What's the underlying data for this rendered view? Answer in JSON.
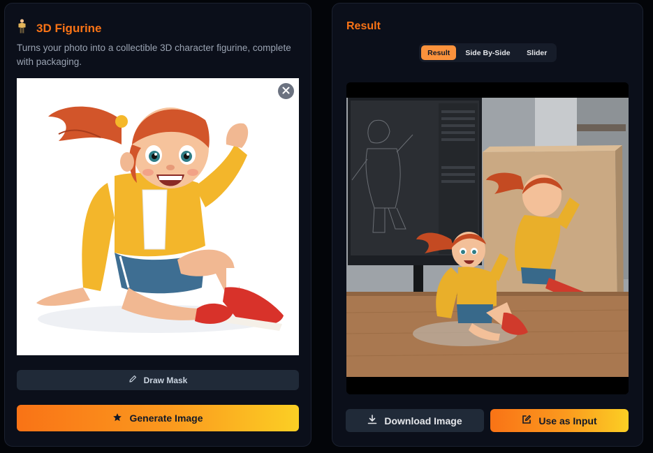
{
  "left": {
    "title": "3D Figurine",
    "subtitle": "Turns your photo into a collectible 3D character figurine, complete with packaging.",
    "image_alt": "cartoon girl with orange ponytail in yellow hoodie",
    "draw_mask_label": "Draw Mask",
    "generate_label": "Generate Image"
  },
  "right": {
    "title": "Result",
    "tabs": [
      {
        "label": "Result",
        "active": true
      },
      {
        "label": "Side By-Side",
        "active": false
      },
      {
        "label": "Slider",
        "active": false
      }
    ],
    "download_label": "Download Image",
    "use_input_label": "Use as Input"
  },
  "icons": {
    "figurine": "person-figurine-icon",
    "close": "close-icon",
    "pencil": "pencil-icon",
    "star": "star-icon",
    "download": "download-icon",
    "edit": "edit-icon"
  },
  "colors": {
    "accent": "#f97316",
    "accent_end": "#fbcf24",
    "panel": "#0b0f1a",
    "button_dark": "#202a38"
  }
}
